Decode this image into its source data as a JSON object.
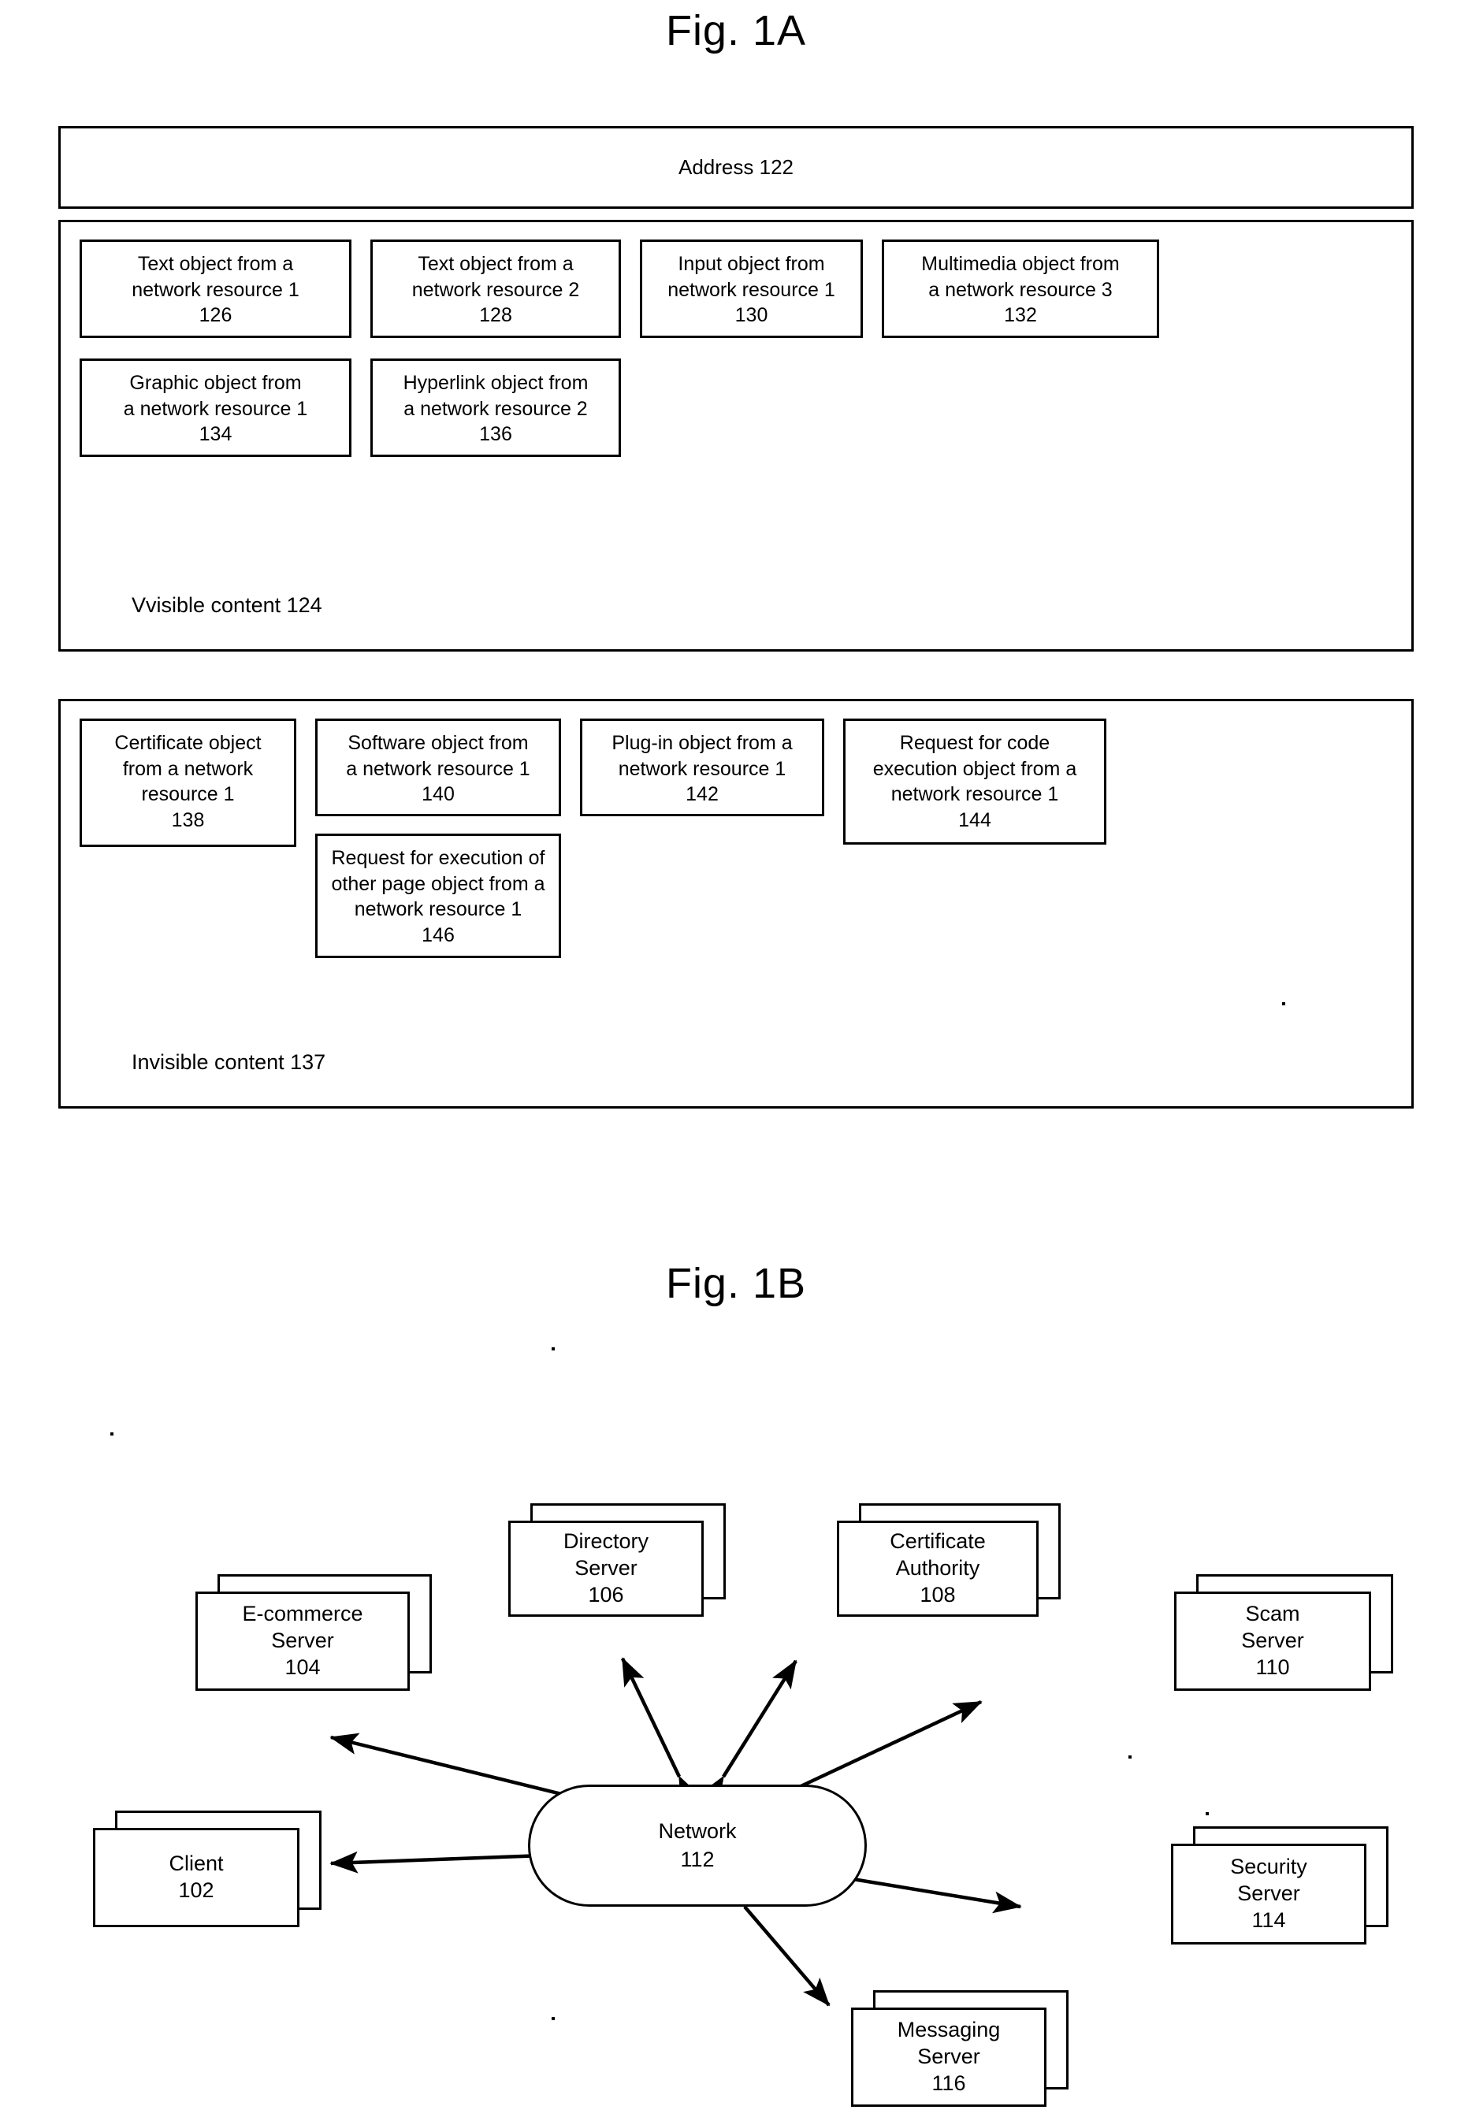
{
  "figures": {
    "fig1a_title": "Fig. 1A",
    "fig1b_title": "Fig. 1B"
  },
  "fig1a": {
    "address_bar": {
      "label": "Address 122"
    },
    "visible_panel": {
      "caption": "Vvisible content 124",
      "objects": [
        {
          "line1": "Text object from a",
          "line2": "network resource 1",
          "num": "126"
        },
        {
          "line1": "Text object from a",
          "line2": "network resource 2",
          "num": "128"
        },
        {
          "line1": "Input object from",
          "line2": "network resource 1",
          "num": "130"
        },
        {
          "line1": "Multimedia object from",
          "line2": "a network resource 3",
          "num": "132"
        },
        {
          "line1": "Graphic object from",
          "line2": "a network resource 1",
          "num": "134"
        },
        {
          "line1": "Hyperlink object from",
          "line2": "a network resource 2",
          "num": "136"
        }
      ]
    },
    "invisible_panel": {
      "caption": "Invisible content 137",
      "objects": [
        {
          "line1": "Certificate object",
          "line2": "from a network",
          "line3": "resource 1",
          "num": "138"
        },
        {
          "line1": "Software object from",
          "line2": "a network resource 1",
          "num": "140"
        },
        {
          "line1": "Plug-in object from a",
          "line2": "network resource 1",
          "num": "142"
        },
        {
          "line1": "Request for code",
          "line2": "execution object from a",
          "line3": "network resource 1",
          "num": "144"
        },
        {
          "line1": "Request for execution of",
          "line2": "other page object from a",
          "line3": "network resource 1",
          "num": "146"
        }
      ]
    }
  },
  "fig1b": {
    "hub": {
      "name": "Network",
      "num": "112"
    },
    "nodes": [
      {
        "id": "client",
        "name": "Client",
        "num": "102"
      },
      {
        "id": "ecommerce",
        "name": "E-commerce",
        "name2": "Server",
        "num": "104"
      },
      {
        "id": "directory",
        "name": "Directory",
        "name2": "Server",
        "num": "106"
      },
      {
        "id": "certificate",
        "name": "Certificate",
        "name2": "Authority",
        "num": "108"
      },
      {
        "id": "scam",
        "name": "Scam",
        "name2": "Server",
        "num": "110"
      },
      {
        "id": "security",
        "name": "Security",
        "name2": "Server",
        "num": "114"
      },
      {
        "id": "messaging",
        "name": "Messaging",
        "name2": "Server",
        "num": "116"
      }
    ]
  },
  "colors": {
    "ink": "#000000",
    "paper": "#ffffff"
  }
}
